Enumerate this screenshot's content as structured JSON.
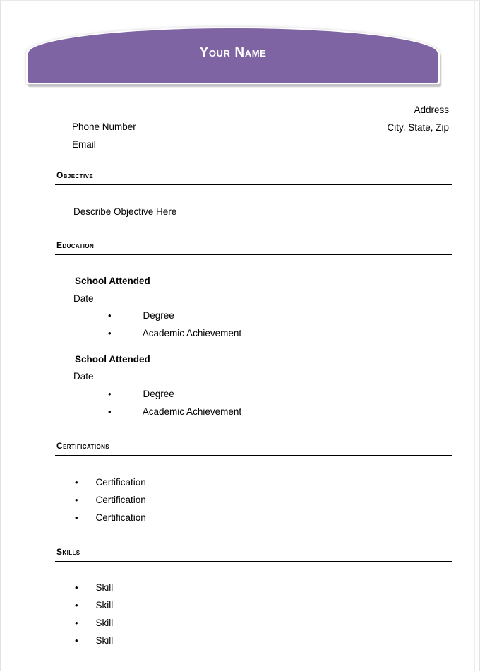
{
  "document": {
    "type": "resume-template",
    "accent_color": "#7e64a3",
    "text_color": "#000000",
    "page_background": "#ffffff"
  },
  "header": {
    "name": "Your Name"
  },
  "contact": {
    "left": [
      "Phone Number",
      "Email"
    ],
    "right": [
      "Address",
      "City, State, Zip"
    ]
  },
  "sections": [
    {
      "title": "Objective",
      "body": "Describe Objective Here"
    },
    {
      "title": "Education",
      "entries": [
        {
          "school": "School Attended",
          "date": "Date",
          "bullets": [
            "Degree",
            "Academic Achievement"
          ]
        },
        {
          "school": "School Attended",
          "date": "Date",
          "bullets": [
            "Degree",
            "Academic Achievement"
          ]
        }
      ]
    },
    {
      "title": "Certifications",
      "bullets": [
        "Certification",
        "Certification",
        "Certification"
      ]
    },
    {
      "title": "Skills",
      "bullets": [
        "Skill",
        "Skill",
        "Skill",
        "Skill"
      ]
    }
  ],
  "bullet_glyph": "•"
}
